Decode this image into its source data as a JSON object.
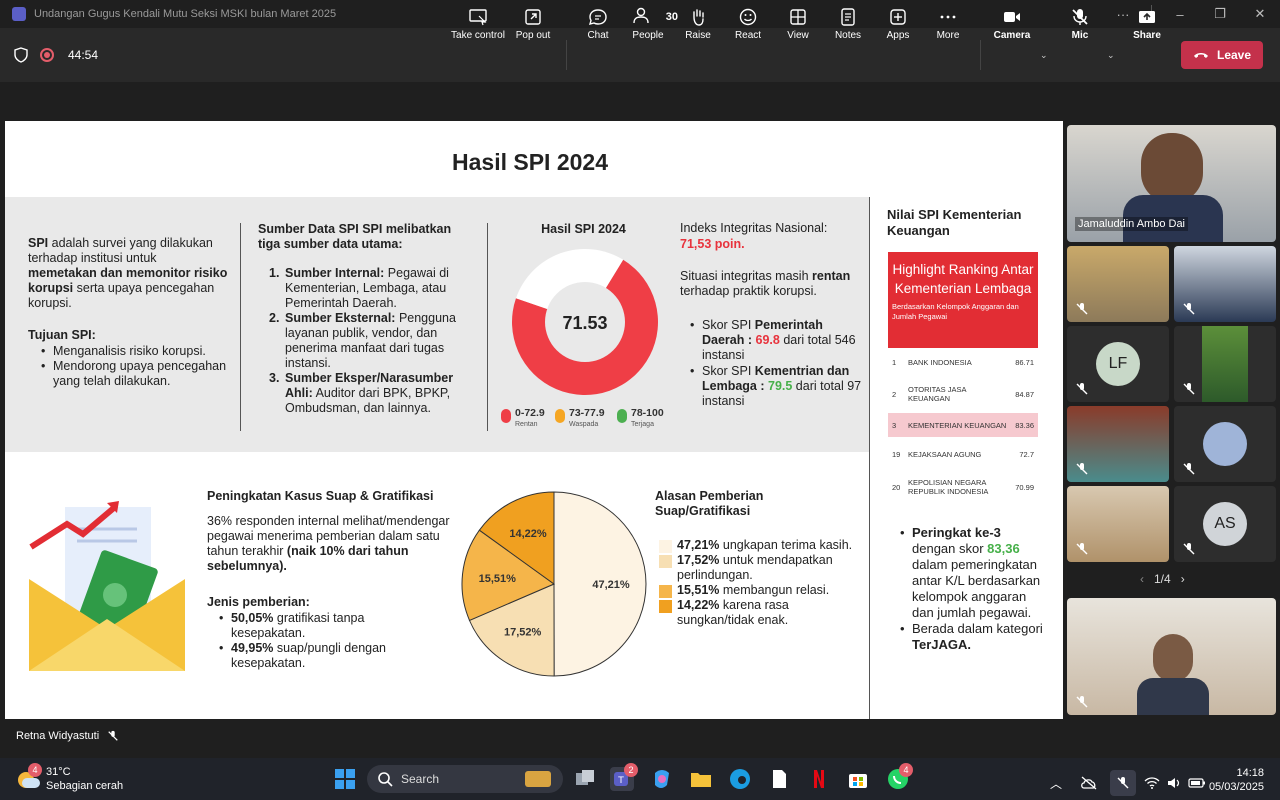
{
  "window": {
    "title": "Undangan Gugus Kendali Mutu Seksi MSKI bulan Maret 2025",
    "controls": [
      "···",
      "–",
      "❐",
      "✕"
    ]
  },
  "meeting": {
    "timer": "44:54",
    "toolbar": [
      {
        "id": "take-control",
        "label": "Take control"
      },
      {
        "id": "pop-out",
        "label": "Pop out"
      },
      {
        "id": "chat",
        "label": "Chat"
      },
      {
        "id": "people",
        "label": "People",
        "count": "30"
      },
      {
        "id": "raise",
        "label": "Raise"
      },
      {
        "id": "react",
        "label": "React"
      },
      {
        "id": "view",
        "label": "View"
      },
      {
        "id": "notes",
        "label": "Notes"
      },
      {
        "id": "apps",
        "label": "Apps"
      },
      {
        "id": "more",
        "label": "More"
      },
      {
        "id": "camera",
        "label": "Camera"
      },
      {
        "id": "mic",
        "label": "Mic"
      },
      {
        "id": "share",
        "label": "Share"
      }
    ],
    "leave_label": "Leave",
    "speaker_name": "Retna Widyastuti",
    "pager": "1/4",
    "participants": {
      "main_name": "Jamaluddin Ambo Dai",
      "initials_1": "LF",
      "initials_2": "AS"
    }
  },
  "slide": {
    "title": "Hasil SPI 2024",
    "spi_def": {
      "term": "SPI",
      "text1": " adalah survei yang dilakukan terhadap institusi untuk ",
      "bold": "memetakan dan memonitor risiko korupsi",
      "text2": " serta upaya pencegahan korupsi."
    },
    "tujuan_title": "Tujuan SPI:",
    "tujuan": [
      "Menganalisis risiko korupsi.",
      "Mendorong upaya pencegahan yang telah dilakukan."
    ],
    "sumber_title": "Sumber Data SPI SPI melibatkan tiga sumber data utama:",
    "sumber": [
      {
        "n": "1.",
        "head": "Sumber Internal:",
        "text": " Pegawai di Kementerian, Lembaga, atau Pemerintah Daerah."
      },
      {
        "n": "2.",
        "head": "Sumber Eksternal:",
        "text": " Pengguna layanan publik, vendor, dan penerima manfaat dari tugas instansi."
      },
      {
        "n": "3.",
        "head": "Sumber Eksper/Narasumber Ahli:",
        "text": " Auditor dari BPK, BPKP, Ombudsman, dan lainnya."
      }
    ],
    "donut_title": "Hasil SPI 2024",
    "donut_value": "71.53",
    "legend": [
      {
        "range": "0-72.9",
        "label": "Rentan",
        "color": "#ef3e46"
      },
      {
        "range": "73-77.9",
        "label": "Waspada",
        "color": "#f5a623"
      },
      {
        "range": "78-100",
        "label": "Terjaga",
        "color": "#4caf50"
      }
    ],
    "indeks_label": "Indeks Integritas Nasional:",
    "indeks_value": "71,53 poin.",
    "situasi": {
      "t1": "Situasi integritas masih ",
      "b": "rentan",
      "t2": " terhadap praktik korupsi."
    },
    "skor": [
      {
        "t1": "Skor SPI ",
        "b": "Pemerintah Daerah :",
        "v": " 69.8",
        "t2": " dari total 546 instansi",
        "color": "red"
      },
      {
        "t1": "Skor SPI ",
        "b": "Kementrian dan Lembaga :",
        "v": " 79.5",
        "t2": " dari total 97 instansi",
        "color": "green"
      }
    ],
    "kasus_title": "Peningkatan Kasus Suap & Gratifikasi",
    "kasus_text": "36% responden internal melihat/mendengar pegawai menerima pemberian dalam satu tahun terakhir ",
    "kasus_bold": "(naik 10% dari tahun sebelumnya).",
    "jenis_title": "Jenis pemberian:",
    "jenis": [
      {
        "b": "50,05%",
        "t": " gratifikasi tanpa kesepakatan."
      },
      {
        "b": "49,95%",
        "t": " suap/pungli dengan kesepakatan."
      }
    ],
    "alasan_title": "Alasan Pemberian Suap/Gratifikasi",
    "alasan": [
      {
        "b": "47,21%",
        "t": " ungkapan terima kasih.",
        "color": "#fdf3e3"
      },
      {
        "b": "17,52%",
        "t": " untuk mendapatkan perlindungan.",
        "color": "#f7dfb3"
      },
      {
        "b": "15,51%",
        "t": " membangun relasi.",
        "color": "#f5b54a"
      },
      {
        "b": "14,22%",
        "t": " karena rasa sungkan/tidak enak.",
        "color": "#f0a020"
      }
    ],
    "side_title": "Nilai SPI Kementerian Keuangan",
    "rank_box_title": "Highlight Ranking Antar Kementerian Lembaga",
    "rank_box_sub": "Berdasarkan Kelompok Anggaran dan Jumlah Pegawai",
    "ranking": [
      {
        "rank": "1",
        "name": "BANK INDONESIA",
        "value": "86.71"
      },
      {
        "rank": "2",
        "name": "OTORITAS JASA KEUANGAN",
        "value": "84.87"
      },
      {
        "rank": "3",
        "name": "KEMENTERIAN KEUANGAN",
        "value": "83.36"
      },
      {
        "rank": "19",
        "name": "KEJAKSAAN AGUNG",
        "value": "72.7"
      },
      {
        "rank": "20",
        "name": "KEPOLISIAN NEGARA REPUBLIK INDONESIA",
        "value": "70.99"
      }
    ],
    "peringkat": {
      "b": "Peringkat ke-3",
      "t1": " dengan skor ",
      "v": "83,36",
      "t2": " dalam pemeringkatan antar K/L berdasarkan kelompok anggaran dan jumlah pegawai."
    },
    "berada": {
      "t": "Berada dalam kategori ",
      "b": "TerJAGA."
    },
    "chart_data": [
      {
        "type": "pie",
        "title": "Hasil SPI 2024",
        "center_label": "71.53",
        "values": [
          71.53,
          28.47
        ],
        "categories": [
          "",
          ""
        ],
        "colors": [
          "#ef3e46",
          "#ffffff"
        ]
      },
      {
        "type": "pie",
        "categories": [
          "47,21%",
          "17,52%",
          "15,51%",
          "14,22%"
        ],
        "values": [
          47.21,
          17.52,
          15.51,
          14.22
        ],
        "colors": [
          "#fdf3e3",
          "#f7dfb3",
          "#f5b54a",
          "#f0a020"
        ]
      }
    ]
  },
  "taskbar": {
    "weather_temp": "31°C",
    "weather_desc": "Sebagian cerah",
    "weather_badge": "4",
    "search": "Search",
    "teams_badge": "2",
    "whatsapp_badge": "4",
    "time": "14:18",
    "date": "05/03/2025"
  }
}
